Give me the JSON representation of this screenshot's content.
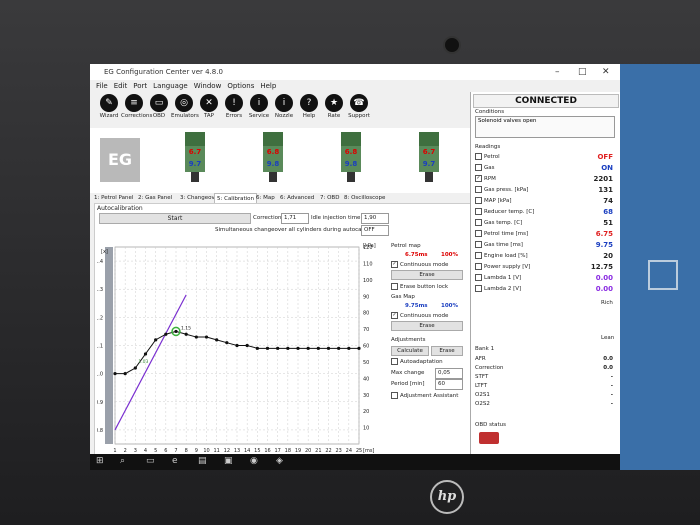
{
  "window": {
    "title": "EG Configuration Center ver 4.8.0"
  },
  "menu": [
    "File",
    "Edit",
    "Port",
    "Language",
    "Window",
    "Options",
    "Help"
  ],
  "toolbar": [
    {
      "label": "Wizard",
      "icon": "wand-icon",
      "glyph": "✎"
    },
    {
      "label": "Corrections",
      "icon": "corrections-icon",
      "glyph": "≡"
    },
    {
      "label": "OBD",
      "icon": "obd-icon",
      "glyph": "▭"
    },
    {
      "label": "Emulators",
      "icon": "emulators-icon",
      "glyph": "◎"
    },
    {
      "label": "TAP",
      "icon": "tap-icon",
      "glyph": "✕"
    },
    {
      "label": "Errors",
      "icon": "errors-icon",
      "glyph": "!"
    },
    {
      "label": "Service",
      "icon": "service-icon",
      "glyph": "i"
    },
    {
      "label": "Nozzle",
      "icon": "nozzle-icon",
      "glyph": "i"
    },
    {
      "label": "Help",
      "icon": "help-icon",
      "glyph": "?"
    },
    {
      "label": "Rate",
      "icon": "rate-icon",
      "glyph": "★"
    },
    {
      "label": "Support",
      "icon": "support-icon",
      "glyph": "☎"
    }
  ],
  "logo": "EG",
  "injectors": [
    {
      "petrol": "6.7",
      "gas": "9.7"
    },
    {
      "petrol": "6.8",
      "gas": "9.8"
    },
    {
      "petrol": "6.8",
      "gas": "9.8"
    },
    {
      "petrol": "6.7",
      "gas": "9.7"
    }
  ],
  "tabs": [
    "1: Petrol Panel",
    "2: Gas Panel",
    "3: Changeover",
    "5: Calibration",
    "6: Map",
    "6: Advanced",
    "7: OBD",
    "8: Oscilloscope"
  ],
  "active_tab": 3,
  "autocal": {
    "section": "Autocalibration",
    "start": "Start",
    "correction_label": "Correction",
    "correction_value": "1,71",
    "idle_label": "Idle injection time",
    "idle_value": "1,90",
    "simultaneous_label": "Simultaneous changeover all cylinders during autocalibration",
    "simultaneous_value": "OFF"
  },
  "mid": {
    "petrol_map": "Petrol map",
    "petrol_ms": "6.75ms",
    "petrol_pct": "100%",
    "continuous_mode": "Continuous mode",
    "erase": "Erase",
    "erase_lock": "Erase button lock",
    "gas_map": "Gas Map",
    "gas_ms": "9.75ms",
    "gas_pct": "100%",
    "adjustments": "Adjustments",
    "calculate": "Calculate",
    "autoadaptation": "Autoadaptation",
    "max_change": "Max change",
    "max_change_value": "0,05",
    "period": "Period [min]",
    "period_value": "60",
    "adjustment_assistant": "Adjustment Assistant"
  },
  "status": "CONNECTED",
  "conditions": {
    "title": "Conditions",
    "text": "Solenoid valves open"
  },
  "readings_title": "Readings",
  "readings": [
    {
      "label": "Petrol",
      "value": "OFF",
      "color": "#e02020",
      "checked": false
    },
    {
      "label": "Gas",
      "value": "ON",
      "color": "#1a3ec0",
      "checked": false
    },
    {
      "label": "RPM",
      "value": "2201",
      "color": "#222222",
      "checked": true
    },
    {
      "label": "Gas press. [kPa]",
      "value": "131",
      "color": "#222222",
      "checked": false
    },
    {
      "label": "MAP [kPa]",
      "value": "74",
      "color": "#222222",
      "checked": false
    },
    {
      "label": "Reducer temp. [C]",
      "value": "68",
      "color": "#1a3ec0",
      "checked": false
    },
    {
      "label": "Gas temp. [C]",
      "value": "51",
      "color": "#222222",
      "checked": false
    },
    {
      "label": "Petrol time [ms]",
      "value": "6.75",
      "color": "#e02020",
      "checked": false
    },
    {
      "label": "Gas time [ms]",
      "value": "9.75",
      "color": "#1a3ec0",
      "checked": false
    },
    {
      "label": "Engine load [%]",
      "value": "20",
      "color": "#222222",
      "checked": false
    },
    {
      "label": "Power supply [V]",
      "value": "12.75",
      "color": "#222222",
      "checked": false
    },
    {
      "label": "Lambda 1 [V]",
      "value": "0.00",
      "color": "#8a2be2",
      "checked": false
    },
    {
      "label": "Lambda 2 [V]",
      "value": "0.00",
      "color": "#8a2be2",
      "checked": false
    }
  ],
  "rich": "Rich",
  "lean": "Lean",
  "bank": {
    "title": "Bank 1",
    "rows": [
      {
        "label": "AFR",
        "value": "0.0"
      },
      {
        "label": "Correction",
        "value": "0.0"
      },
      {
        "label": "STFT",
        "value": "-"
      },
      {
        "label": "LTFT",
        "value": "-"
      },
      {
        "label": "O2S1",
        "value": "-"
      },
      {
        "label": "O2S2",
        "value": "-"
      }
    ]
  },
  "obd_status": "OBD status",
  "hp": "hp",
  "chart_data": {
    "type": "line",
    "x": [
      1,
      2,
      3,
      4,
      5,
      6,
      7,
      8,
      9,
      10,
      11,
      12,
      13,
      14,
      15,
      16,
      17,
      18,
      19,
      20,
      21,
      22,
      23,
      24,
      25
    ],
    "xlabel": "[ms]",
    "left_axis_label": "[x]",
    "right_axis_label": "[kPa]",
    "left_ticks": [
      "0.8",
      "0.9",
      "1.0",
      "1.1",
      "1.2",
      "1.3",
      "1.4"
    ],
    "right_ticks": [
      "10",
      "20",
      "30",
      "40",
      "50",
      "60",
      "70",
      "80",
      "90",
      "100",
      "110",
      "120"
    ],
    "ylim": [
      0.75,
      1.45
    ],
    "series": [
      {
        "values": [
          1.0,
          1.0,
          1.02,
          1.07,
          1.12,
          1.14,
          1.15,
          1.14,
          1.13,
          1.13,
          1.12,
          1.11,
          1.1,
          1.1,
          1.09,
          1.09,
          1.09,
          1.09,
          1.09,
          1.09,
          1.09,
          1.09,
          1.09,
          1.09,
          1.09
        ],
        "color": "#111111"
      }
    ],
    "annotations": [
      "1.03",
      "1.15"
    ]
  }
}
